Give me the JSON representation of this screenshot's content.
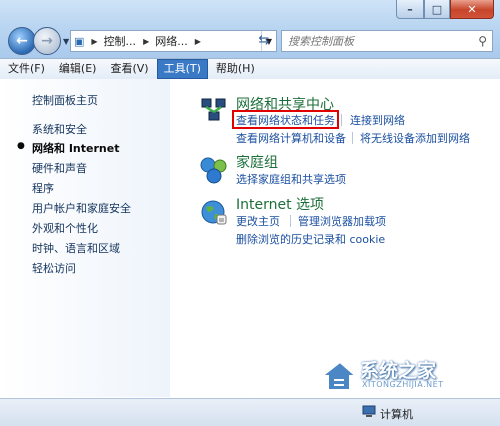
{
  "address": {
    "segments": [
      "控制...",
      "网络..."
    ]
  },
  "search": {
    "placeholder": "搜索控制面板"
  },
  "menu": [
    {
      "label": "文件(F)"
    },
    {
      "label": "编辑(E)"
    },
    {
      "label": "查看(V)"
    },
    {
      "label": "工具(T)",
      "active": true
    },
    {
      "label": "帮助(H)"
    }
  ],
  "sidebar": {
    "home": "控制面板主页",
    "items": [
      {
        "label": "系统和安全"
      },
      {
        "label": "网络和 Internet",
        "current": true
      },
      {
        "label": "硬件和声音"
      },
      {
        "label": "程序"
      },
      {
        "label": "用户帐户和家庭安全"
      },
      {
        "label": "外观和个性化"
      },
      {
        "label": "时钟、语言和区域"
      },
      {
        "label": "轻松访问"
      }
    ]
  },
  "categories": {
    "network": {
      "title": "网络和共享中心",
      "links": [
        "查看网络状态和任务",
        "连接到网络",
        "查看网络计算机和设备",
        "将无线设备添加到网络"
      ],
      "icon": "network-center-icon"
    },
    "homegroup": {
      "title": "家庭组",
      "links": [
        "选择家庭组和共享选项"
      ],
      "icon": "homegroup-icon"
    },
    "internet": {
      "title": "Internet 选项",
      "links": [
        "更改主页",
        "管理浏览器加载项",
        "删除浏览的历史记录和 cookie"
      ],
      "icon": "internet-options-icon"
    }
  },
  "watermark": {
    "title": "系统之家",
    "url": "XITONGZHIJIA.NET"
  },
  "status": {
    "text": "计算机"
  },
  "colors": {
    "highlight": "#e00000",
    "link": "#1b4fa0",
    "category_title": "#1c6f3a"
  }
}
